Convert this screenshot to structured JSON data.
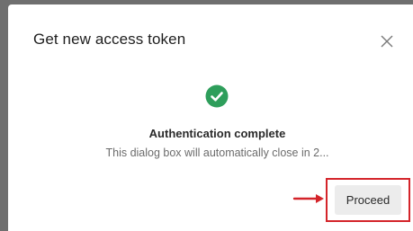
{
  "dialog": {
    "title": "Get new access token",
    "close_icon": "close-icon",
    "status_icon": "check-circle-icon",
    "status_color": "#2e9e5b",
    "heading": "Authentication complete",
    "message": "This dialog box will automatically close in 2...",
    "proceed_label": "Proceed"
  },
  "annotation": {
    "arrow_icon": "arrow-right-icon",
    "highlight_color": "#d4242a"
  }
}
